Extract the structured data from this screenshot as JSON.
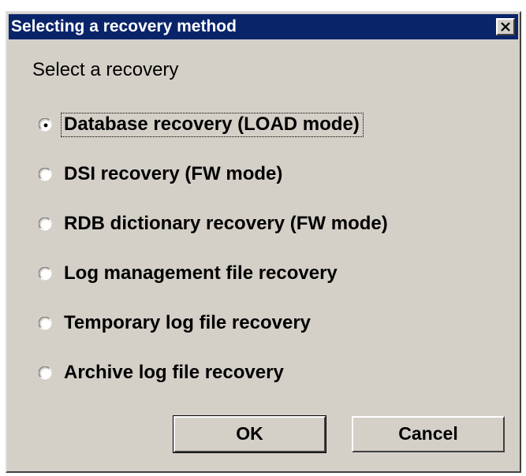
{
  "window": {
    "title": "Selecting a recovery method",
    "close_icon": "close-icon"
  },
  "group": {
    "label": "Select a recovery"
  },
  "options": [
    {
      "label": "Database recovery (LOAD mode)",
      "selected": true
    },
    {
      "label": "DSI recovery (FW mode)",
      "selected": false
    },
    {
      "label": "RDB dictionary recovery (FW mode)",
      "selected": false
    },
    {
      "label": "Log management file recovery",
      "selected": false
    },
    {
      "label": "Temporary log file recovery",
      "selected": false
    },
    {
      "label": "Archive log file recovery",
      "selected": false
    }
  ],
  "buttons": {
    "ok_label": "OK",
    "cancel_label": "Cancel"
  },
  "colors": {
    "titlebar": "#0a246a",
    "face": "#d4d0c8"
  }
}
